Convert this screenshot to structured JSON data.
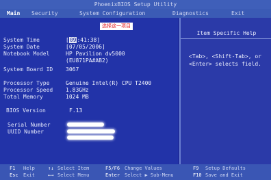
{
  "title": "PhoenixBIOS Setup Utility",
  "menu": {
    "items": [
      {
        "label": "Main",
        "active": true
      },
      {
        "label": "Security",
        "active": false
      },
      {
        "label": "System Configuration",
        "active": false
      },
      {
        "label": "Diagnostics",
        "active": false
      },
      {
        "label": "Exit",
        "active": false
      }
    ]
  },
  "annotation": "选择这一项目",
  "main": {
    "system_time": {
      "label": "System Time",
      "value_cursor": "09",
      "value_rest": ":41:38]"
    },
    "system_date": {
      "label": "System Date",
      "value": "[07/05/2006]"
    },
    "notebook_model": {
      "label": "Notebook Model",
      "value": "HP Pavilion dv5000",
      "value2": "(EU871PA#AB2)"
    },
    "board_id": {
      "label": "System Board ID",
      "value": "3067"
    },
    "processor_type": {
      "label": "Processor Type",
      "value": "Genuine Intel(R) CPU T2400"
    },
    "processor_speed": {
      "label": "Processor Speed",
      "value": "1.83GHz"
    },
    "total_memory": {
      "label": "Total Memory",
      "value": "1024 MB"
    },
    "bios_version": {
      "label": "BIOS Version",
      "value": "F.13"
    },
    "serial_number": {
      "label": "Serial Number"
    },
    "uuid_number": {
      "label": "UUID Number"
    }
  },
  "help": {
    "title": "Item Specific Help",
    "lines": [
      "<Tab>, <Shift-Tab>, or",
      "<Enter> selects field."
    ]
  },
  "footer": {
    "row1": [
      {
        "key": "F1",
        "desc": "Help"
      },
      {
        "key": "↑↓",
        "desc": "Select Item"
      },
      {
        "key": "F5/F6",
        "desc": "Change Values"
      },
      {
        "key": "F9",
        "desc": "Setup Defaults"
      }
    ],
    "row2": [
      {
        "key": "Esc",
        "desc": "Exit"
      },
      {
        "key": "←→",
        "desc": "Select Menu"
      },
      {
        "key": "Enter",
        "desc": "Select ▶ Sub-Menu"
      },
      {
        "key": "F10",
        "desc": "Save and Exit"
      }
    ]
  }
}
